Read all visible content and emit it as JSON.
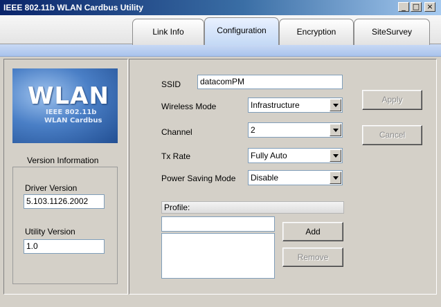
{
  "window": {
    "title": "IEEE 802.11b WLAN Cardbus Utility",
    "controls": {
      "minimize": "_",
      "maximize": "□",
      "close": "×"
    }
  },
  "tabs": [
    {
      "label": "Link Info"
    },
    {
      "label": "Configuration",
      "active": true
    },
    {
      "label": "Encryption"
    },
    {
      "label": "SiteSurvey"
    }
  ],
  "logo": {
    "main": "WLAN",
    "line1": "IEEE 802.11b",
    "line2": "WLAN Cardbus"
  },
  "version": {
    "heading": "Version Information",
    "driver_label": "Driver Version",
    "driver_value": "5.103.1126.2002",
    "utility_label": "Utility Version",
    "utility_value": "1.0"
  },
  "config": {
    "ssid_label": "SSID",
    "ssid_value": "datacomPM",
    "wireless_mode_label": "Wireless Mode",
    "wireless_mode_value": "Infrastructure",
    "channel_label": "Channel",
    "channel_value": "2",
    "tx_rate_label": "Tx Rate",
    "tx_rate_value": "Fully Auto",
    "power_saving_label": "Power Saving Mode",
    "power_saving_value": "Disable"
  },
  "buttons": {
    "apply": "Apply",
    "cancel": "Cancel",
    "add": "Add",
    "remove": "Remove"
  },
  "profile": {
    "header": "Profile:",
    "name_value": ""
  }
}
